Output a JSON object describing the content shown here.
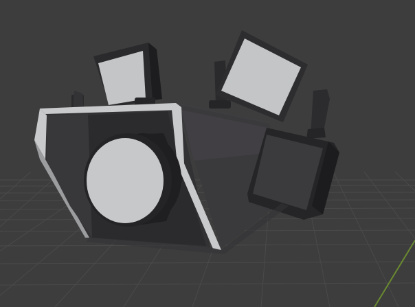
{
  "viewport": {
    "background_color": "#3d3d3d",
    "grid_color": "#4a4a4a",
    "axis_x_color": "#8a3a3a",
    "axis_y_color": "#6a8a30",
    "grid_visible": true
  },
  "scene": {
    "colors": {
      "body_dark": "#2f2e31",
      "body_mid": "#3a393c",
      "body_side": "#434246",
      "bevel_light": "#c9cacb",
      "bevel_shade": "#9c9d9f",
      "lens_rim": "#1f1f21",
      "lens_face": "#c7c8ca",
      "screen_face": "#c4c5c7",
      "screen_frame": "#2a2a2c",
      "screen_dark_face": "#3b3a3d",
      "knob": "#252527"
    },
    "objects": [
      {
        "name": "main-body"
      },
      {
        "name": "front-lens"
      },
      {
        "name": "left-monitor"
      },
      {
        "name": "top-monitor"
      },
      {
        "name": "right-panel"
      },
      {
        "name": "right-handle"
      },
      {
        "name": "left-handle"
      }
    ]
  }
}
